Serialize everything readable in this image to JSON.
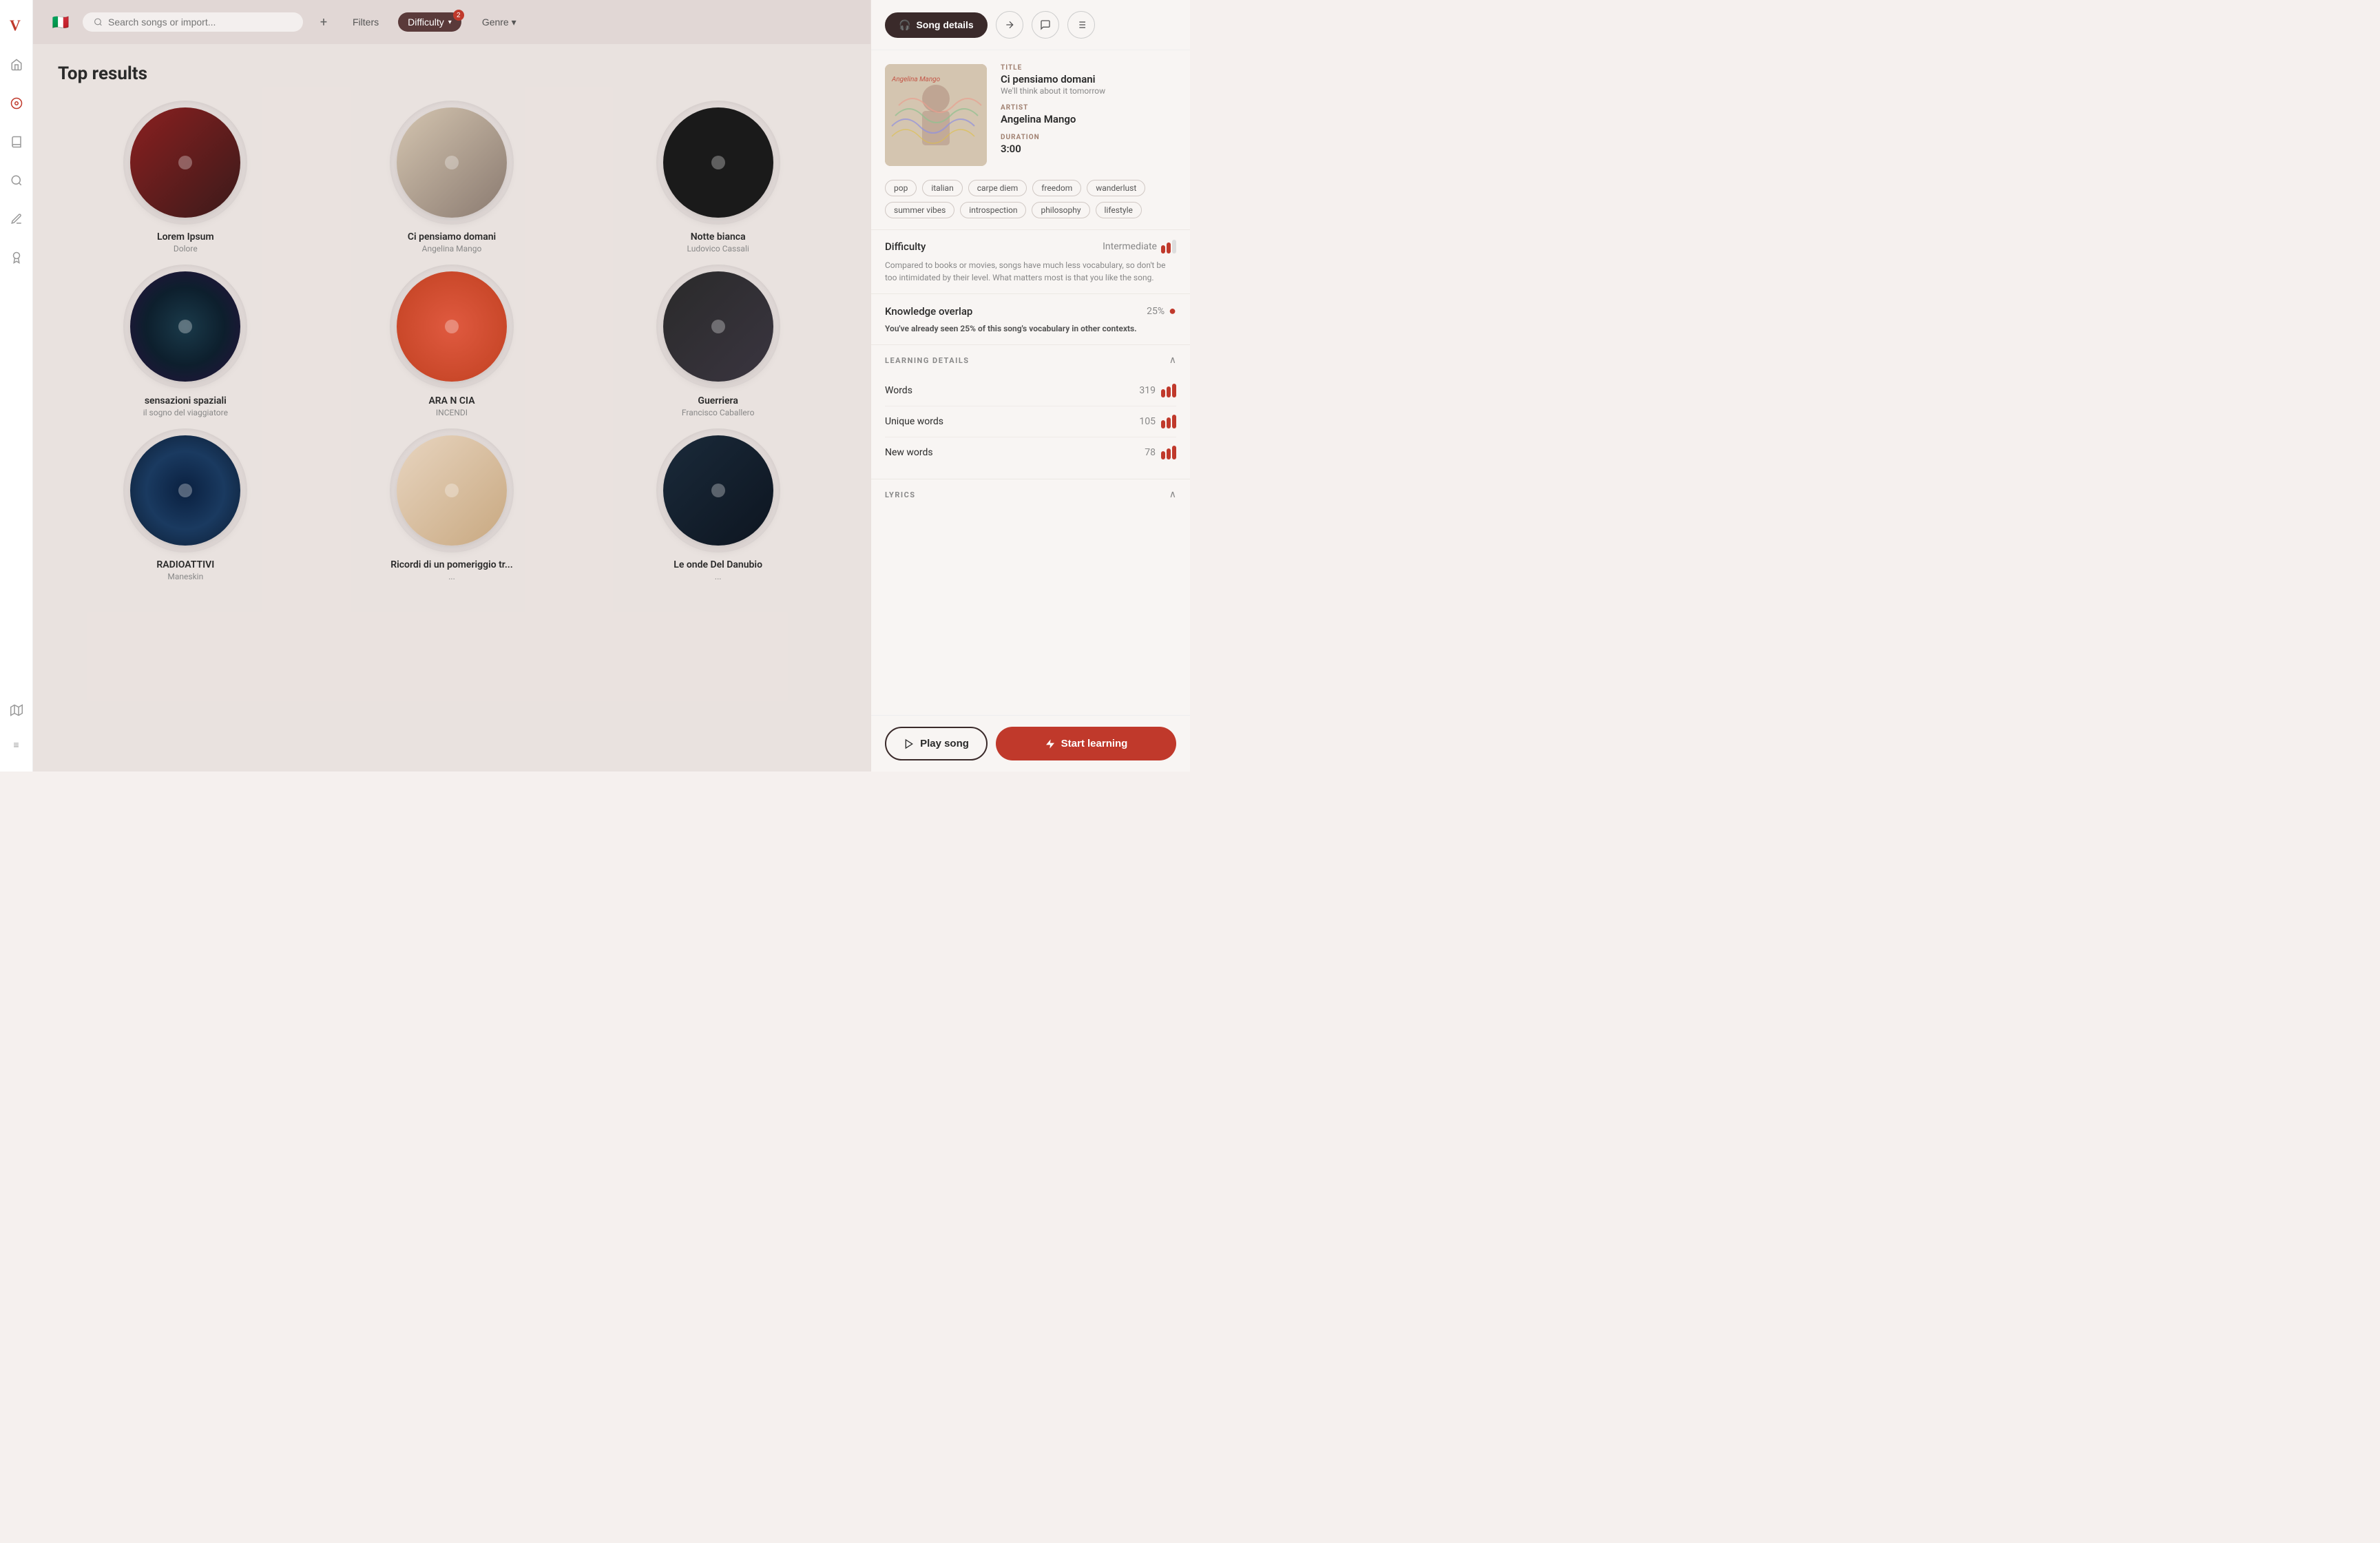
{
  "app": {
    "logo": "V"
  },
  "topbar": {
    "flag_emoji": "🇮🇹",
    "search_placeholder": "Search songs or import...",
    "plus_label": "+",
    "filters_label": "Filters",
    "difficulty_label": "Difficulty",
    "difficulty_badge": "2",
    "genre_label": "Genre ▾"
  },
  "main": {
    "section_title": "Top results",
    "songs": [
      {
        "name": "Lorem Ipsum",
        "artist": "Dolore",
        "disc_class": "disc-1"
      },
      {
        "name": "Ci pensiamo domani",
        "artist": "Angelina Mango",
        "disc_class": "disc-2"
      },
      {
        "name": "Notte bianca",
        "artist": "Ludovico Cassali",
        "disc_class": "disc-3"
      },
      {
        "name": "sensazioni spaziali",
        "artist": "il sogno del viaggiatore",
        "disc_class": "disc-4"
      },
      {
        "name": "ARA N CIA",
        "artist": "INCENDI",
        "disc_class": "disc-5"
      },
      {
        "name": "Guerriera",
        "artist": "Francisco Caballero",
        "disc_class": "disc-6"
      },
      {
        "name": "RADIOATTIVI",
        "artist": "Maneskin",
        "disc_class": "disc-7"
      },
      {
        "name": "Ricordi di un pomeriggio tr...",
        "artist": "...",
        "disc_class": "disc-8"
      },
      {
        "name": "Le onde Del Danubio",
        "artist": "...",
        "disc_class": "disc-9"
      }
    ]
  },
  "sidebar": {
    "nav_items": [
      {
        "icon": "⌂",
        "name": "home",
        "active": false
      },
      {
        "icon": "◉",
        "name": "explore",
        "active": true
      },
      {
        "icon": "📖",
        "name": "library",
        "active": false
      },
      {
        "icon": "👓",
        "name": "review",
        "active": false
      },
      {
        "icon": "✏️",
        "name": "practice",
        "active": false
      },
      {
        "icon": "🎒",
        "name": "collections",
        "active": false
      },
      {
        "icon": "🗺",
        "name": "map",
        "active": false
      }
    ],
    "menu_icon": "≡"
  },
  "right_panel": {
    "tabs": [
      {
        "label": "Song details",
        "icon": "🎧",
        "active": true
      },
      {
        "label": "translate",
        "icon": "⇄"
      },
      {
        "label": "review",
        "icon": "💬"
      },
      {
        "label": "settings",
        "icon": "⚙"
      }
    ],
    "song": {
      "title_label": "TITLE",
      "title": "Ci pensiamo domani",
      "subtitle": "We'll think about it tomorrow",
      "artist_label": "ARTIST",
      "artist": "Angelina Mango",
      "duration_label": "DURATION",
      "duration": "3:00"
    },
    "tags": [
      "pop",
      "italian",
      "carpe diem",
      "freedom",
      "wanderlust",
      "summer vibes",
      "introspection",
      "philosophy",
      "lifestyle"
    ],
    "difficulty": {
      "label": "Difficulty",
      "value": "Intermediate",
      "bars_filled": 2,
      "bars_total": 3,
      "description": "Compared to books or movies, songs have much less vocabulary, so don't be too intimidated by their level. What matters most is that you like the song."
    },
    "knowledge": {
      "label": "Knowledge overlap",
      "pct": "25%",
      "description_prefix": "You've already seen",
      "highlight": "25%",
      "description_suffix": "of this song's vocabulary in other contexts."
    },
    "learning_details": {
      "header": "LEARNING DETAILS",
      "items": [
        {
          "label": "Words",
          "value": "319",
          "bars_filled": 3,
          "bars_total": 3
        },
        {
          "label": "Unique words",
          "value": "105",
          "bars_filled": 3,
          "bars_total": 3
        },
        {
          "label": "New words",
          "value": "78",
          "bars_filled": 3,
          "bars_total": 3
        }
      ]
    },
    "lyrics": {
      "header": "LYRICS"
    },
    "buttons": {
      "play": "Play song",
      "start": "Start learning"
    }
  }
}
